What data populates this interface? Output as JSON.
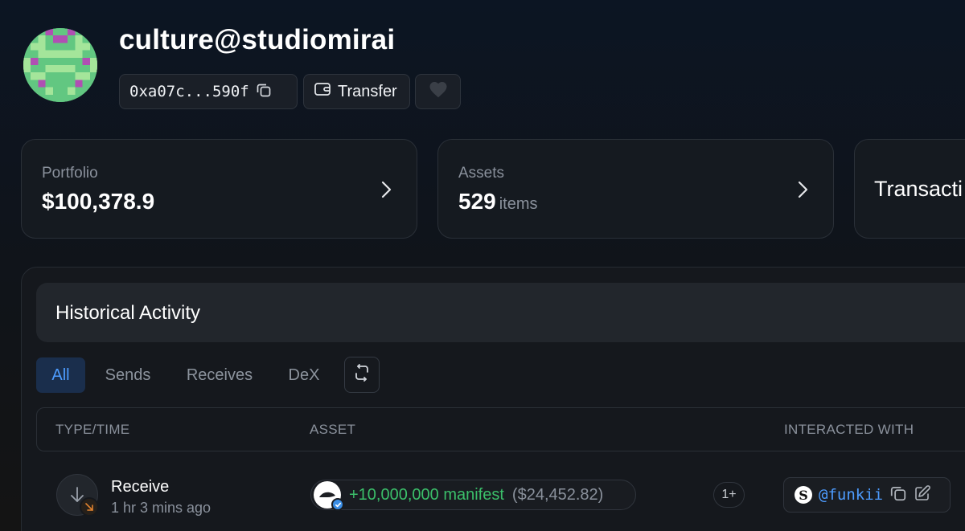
{
  "profile": {
    "username": "culture@studiomirai",
    "address": "0xa07c...590f",
    "transfer_label": "Transfer"
  },
  "cards": {
    "portfolio": {
      "label": "Portfolio",
      "value": "$100,378.9"
    },
    "assets": {
      "label": "Assets",
      "value": "529",
      "unit": "items"
    },
    "transactions": {
      "label": "Transacti"
    }
  },
  "activity": {
    "title": "Historical Activity",
    "tabs": [
      "All",
      "Sends",
      "Receives",
      "DeX"
    ],
    "active_tab": "All",
    "columns": [
      "TYPE/TIME",
      "ASSET",
      "INTERACTED WITH"
    ],
    "rows": [
      {
        "type": "Receive",
        "time": "1 hr 3 mins ago",
        "amount": "+10,000,000 manifest",
        "usd": "($24,452.82)",
        "more": "1+",
        "counterparty": "@funkii",
        "counterparty_logo": "S"
      }
    ]
  },
  "colors": {
    "accent_blue": "#4d9cff",
    "positive_green": "#3bbf6a",
    "muted_text": "#8a919c",
    "card_bg": "#151a20"
  },
  "icons": {
    "address": "copy-icon",
    "transfer": "wallet-icon",
    "favorite": "heart-icon",
    "card_chevron": "chevron-right-icon",
    "filter": "swap-filter-icon",
    "type": "arrow-down-icon",
    "badge": "arrow-down-right-icon",
    "verified": "verified-check-icon",
    "edit": "edit-icon"
  }
}
